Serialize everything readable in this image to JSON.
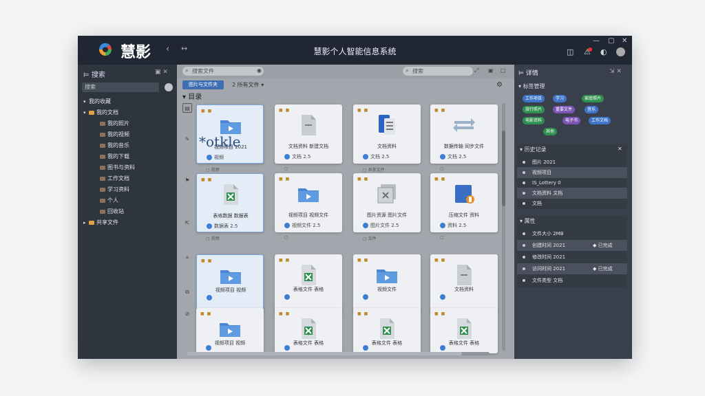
{
  "window": {
    "brand": "慧影",
    "app_title": "慧影个人智能信息系统"
  },
  "left_panel": {
    "title": "搜索",
    "search_placeholder": "搜索",
    "tree": [
      {
        "label": "我的收藏",
        "depth": 0,
        "expanded": true
      },
      {
        "label": "我的文档",
        "depth": 0,
        "expanded": true,
        "folder": true
      },
      {
        "label": "我的照片",
        "depth": 1,
        "folder": true
      },
      {
        "label": "我的视频",
        "depth": 1,
        "folder": true
      },
      {
        "label": "我的音乐",
        "depth": 1,
        "folder": true
      },
      {
        "label": "我的下载",
        "depth": 1,
        "folder": true
      },
      {
        "label": "图书与资料",
        "depth": 1,
        "folder": true
      },
      {
        "label": "工作文档",
        "depth": 1,
        "folder": true
      },
      {
        "label": "学习资料",
        "depth": 1,
        "folder": true
      },
      {
        "label": "个人",
        "depth": 1,
        "folder": true
      },
      {
        "label": "回收站",
        "depth": 1,
        "folder": true
      },
      {
        "label": "共享文件",
        "depth": 0,
        "folder": true
      }
    ]
  },
  "center": {
    "search_placeholder": "搜索文件",
    "search2_placeholder": "搜索",
    "tabs": [
      {
        "label": "图片与文件夹",
        "active": true
      },
      {
        "label": "2 所有文件",
        "active": false
      }
    ],
    "section_title": "目录",
    "overlay_text": "*otkle",
    "cards": [
      {
        "icon": "video-folder-icon",
        "label": "视频项目 2021",
        "meta": "视频",
        "selected": true
      },
      {
        "icon": "document-icon",
        "label": "文档资料 新建文档",
        "meta": "文档 2.5",
        "selected": false
      },
      {
        "icon": "word-document-icon",
        "label": "文档资料",
        "meta": "文档 2.5",
        "selected": false
      },
      {
        "icon": "transfer-icon",
        "label": "数据传输 同步文件",
        "meta": "文档 2.5",
        "selected": false
      },
      {
        "icon": "excel-icon",
        "label": "表格数据 数据表",
        "meta": "数据表 2.5",
        "selected": true
      },
      {
        "icon": "video-folder-icon",
        "label": "视频项目 视频文件",
        "meta": "视频文件 2.5",
        "selected": false
      },
      {
        "icon": "image-stack-icon",
        "label": "图片资源 图片文件",
        "meta": "图片文件 2.5",
        "selected": false
      },
      {
        "icon": "archive-icon",
        "label": "压缩文件 资料",
        "meta": "资料 2.5",
        "selected": false
      },
      {
        "icon": "video-folder-icon",
        "label": "视频项目 视频",
        "meta": "",
        "selected": true
      },
      {
        "icon": "excel-icon",
        "label": "表格文件 表格",
        "meta": "",
        "selected": false
      },
      {
        "icon": "video-folder-icon",
        "label": "视频文件",
        "meta": "",
        "selected": false
      },
      {
        "icon": "document-icon",
        "label": "文档资料",
        "meta": "",
        "selected": false
      },
      {
        "icon": "video-folder-icon",
        "label": "视频项目 视频",
        "meta": "",
        "selected": false
      },
      {
        "icon": "excel-icon",
        "label": "表格文件 表格",
        "meta": "",
        "selected": false
      },
      {
        "icon": "excel-icon",
        "label": "表格文件 表格",
        "meta": "",
        "selected": false
      },
      {
        "icon": "excel-icon",
        "label": "表格文件 表格",
        "meta": "",
        "selected": false
      }
    ],
    "card_footers": [
      "视频",
      "",
      "共享文件",
      "",
      "视频",
      "",
      "文件",
      ""
    ]
  },
  "right_panel": {
    "title": "详情",
    "tags_section": "标签管理",
    "tags": [
      {
        "label": "工作项目",
        "color": "#3f74c9"
      },
      {
        "label": "学习",
        "color": "#3f74c9"
      },
      {
        "label": "家庭照片",
        "color": "#2f8f4e"
      },
      {
        "label": "旅行照片",
        "color": "#2f8f4e"
      },
      {
        "label": "重要文件",
        "color": "#7c54b5"
      },
      {
        "label": "音乐",
        "color": "#3f74c9"
      },
      {
        "label": "电影资料",
        "color": "#2f8f4e"
      },
      {
        "label": "电子书",
        "color": "#7c54b5"
      },
      {
        "label": "工作文档",
        "color": "#3f74c9"
      },
      {
        "label": "其他",
        "color": "#2f8f4e"
      }
    ],
    "history_section": "历史记录",
    "history": [
      {
        "label": "图片 2021"
      },
      {
        "label": "视频项目"
      },
      {
        "label": "IS_Lottery 0"
      },
      {
        "label": "文档资料 文档"
      },
      {
        "label": "文档"
      }
    ],
    "props_section": "属性",
    "props": [
      {
        "label": "文件大小 2MB",
        "value": ""
      },
      {
        "label": "创建时间 2021",
        "value": "◆ 已完成"
      },
      {
        "label": "修改时间 2021",
        "value": ""
      },
      {
        "label": "访问时间 2021",
        "value": "◆ 已完成"
      },
      {
        "label": "文件类型 文档",
        "value": ""
      }
    ]
  }
}
